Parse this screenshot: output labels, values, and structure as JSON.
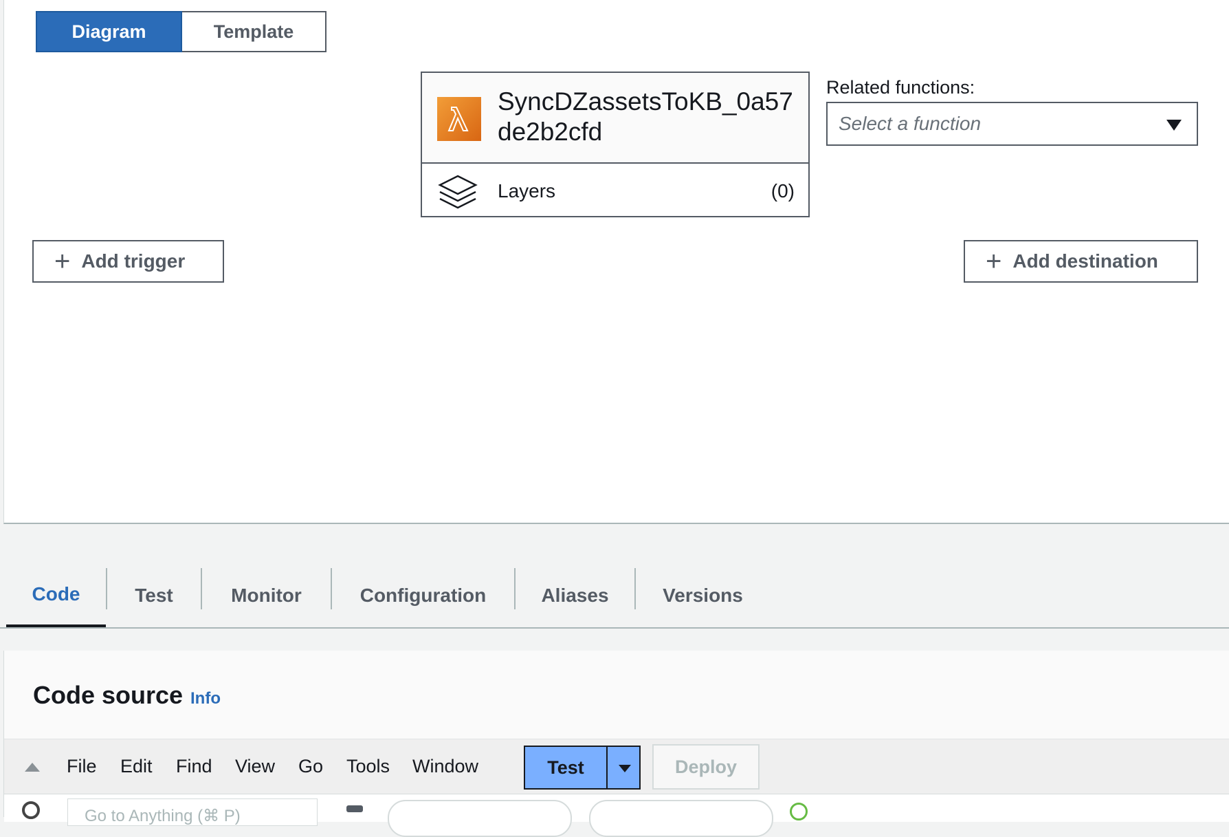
{
  "view_toggle": {
    "diagram_label": "Diagram",
    "template_label": "Template",
    "active": "Diagram"
  },
  "function_card": {
    "name": "SyncDZassetsToKB_0a57de2b2cfd",
    "icon": "lambda-icon",
    "layers_label": "Layers",
    "layers_count": "(0)"
  },
  "related_functions": {
    "label": "Related functions:",
    "placeholder": "Select a function"
  },
  "actions": {
    "add_trigger": "Add trigger",
    "add_destination": "Add destination"
  },
  "tabs": [
    {
      "label": "Code",
      "active": true
    },
    {
      "label": "Test",
      "active": false
    },
    {
      "label": "Monitor",
      "active": false
    },
    {
      "label": "Configuration",
      "active": false
    },
    {
      "label": "Aliases",
      "active": false
    },
    {
      "label": "Versions",
      "active": false
    }
  ],
  "code_source": {
    "title": "Code source",
    "info_label": "Info"
  },
  "ide_menu": {
    "items": [
      "File",
      "Edit",
      "Find",
      "View",
      "Go",
      "Tools",
      "Window"
    ],
    "test_label": "Test",
    "deploy_label": "Deploy",
    "goto_placeholder": "Go to Anything (⌘ P)"
  },
  "colors": {
    "primary_blue": "#2b6cb8",
    "test_button": "#7aafff",
    "lambda_orange": "#d86613",
    "border_dark": "#545b64"
  }
}
